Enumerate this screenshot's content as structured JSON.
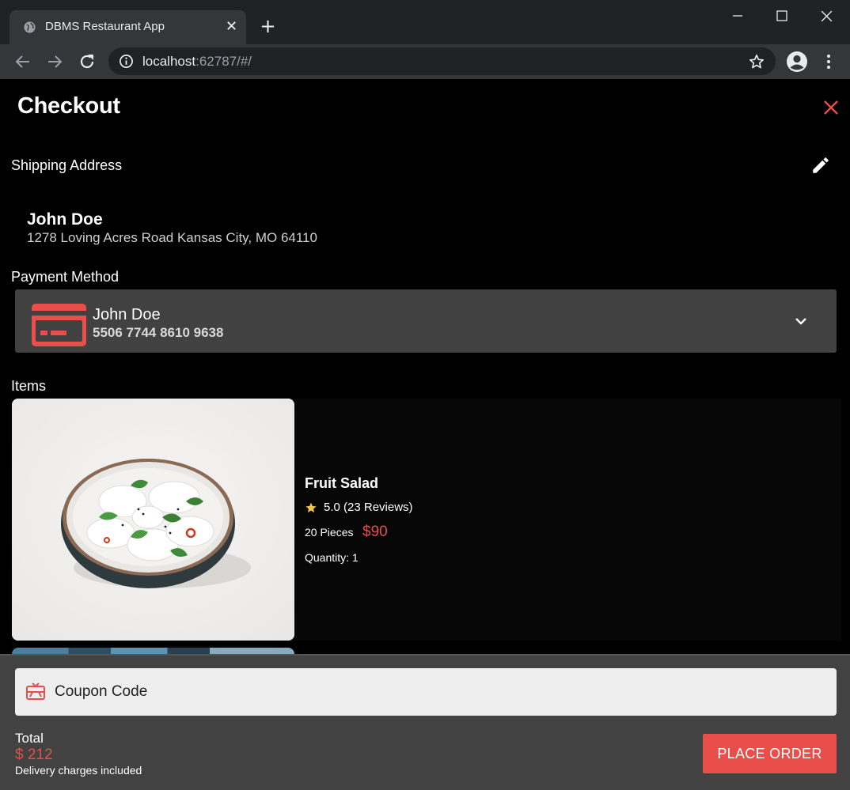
{
  "browser": {
    "tab_title": "DBMS Restaurant App",
    "url_host": "localhost",
    "url_rest": ":62787/#/",
    "icons": [
      "globe-icon",
      "close-icon",
      "plus-icon",
      "minimize-icon",
      "maximize-icon",
      "close-icon",
      "back-arrow-icon",
      "forward-arrow-icon",
      "reload-icon",
      "info-icon",
      "star-outline-icon",
      "profile-icon",
      "kebab-menu-icon"
    ]
  },
  "page": {
    "title": "Checkout",
    "close_icon": "close-icon",
    "accent_color": "#ea4e4a"
  },
  "shipping": {
    "label": "Shipping Address",
    "edit_icon": "pencil-icon",
    "name": "John Doe",
    "address": "1278 Loving Acres Road Kansas City, MO 64110"
  },
  "payment": {
    "label": "Payment Method",
    "card_icon": "credit-card-icon",
    "holder": "John Doe",
    "number": "5506 7744 8610 9638",
    "dropdown_icon": "chevron-down-icon"
  },
  "items": {
    "label": "Items",
    "list": [
      {
        "name": "Fruit Salad",
        "rating": "5.0 (23 Reviews)",
        "pieces": "20 Pieces",
        "price": "$90",
        "quantity": "Quantity: 1"
      }
    ]
  },
  "checkout": {
    "coupon_icon": "gift-card-icon",
    "coupon_placeholder": "Coupon Code",
    "total_label": "Total",
    "total_value": "$ 212",
    "delivery_note": "Delivery charges included",
    "place_order_label": "PLACE ORDER"
  }
}
